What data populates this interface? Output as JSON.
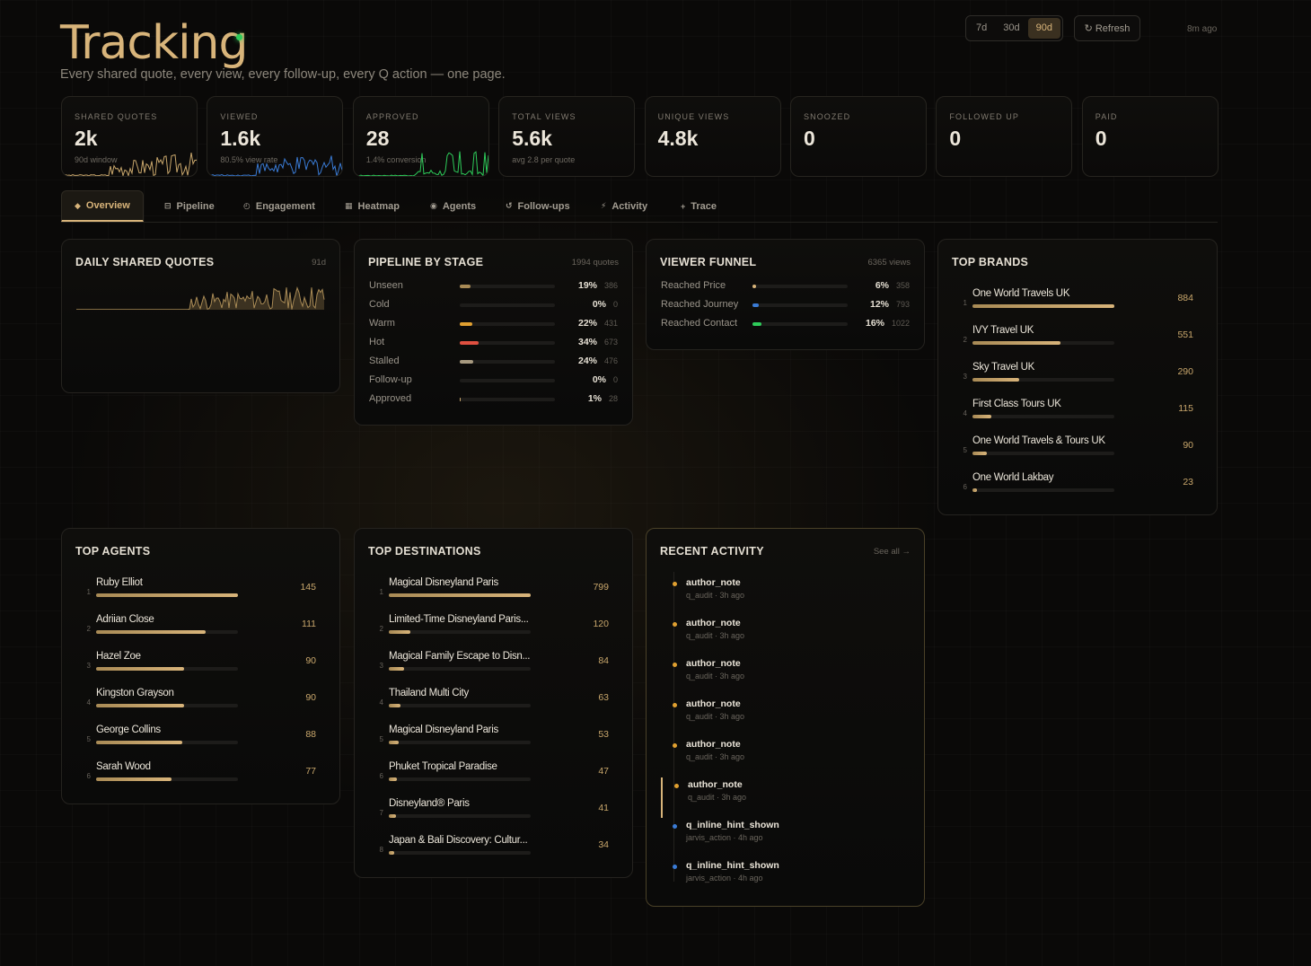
{
  "header": {
    "title": "Tracking",
    "subtitle": "Every shared quote, every view, every follow-up, every Q action — one page.",
    "ranges": [
      "7d",
      "30d",
      "90d"
    ],
    "active_range": "90d",
    "refresh_label": "Refresh",
    "updated": "8m ago"
  },
  "kpis": [
    {
      "label": "SHARED QUOTES",
      "value": "2k",
      "sub": "90d window",
      "spark_color": "#c9a76c"
    },
    {
      "label": "VIEWED",
      "value": "1.6k",
      "sub": "80.5% view rate",
      "spark_color": "#3a7bd5"
    },
    {
      "label": "APPROVED",
      "value": "28",
      "sub": "1.4% conversion",
      "spark_color": "#2ecc5a"
    },
    {
      "label": "TOTAL VIEWS",
      "value": "5.6k",
      "sub": "avg 2.8 per quote",
      "spark_color": ""
    },
    {
      "label": "UNIQUE VIEWS",
      "value": "4.8k",
      "sub": "",
      "spark_color": ""
    },
    {
      "label": "SNOOZED",
      "value": "0",
      "sub": "",
      "spark_color": ""
    },
    {
      "label": "FOLLOWED UP",
      "value": "0",
      "sub": "",
      "spark_color": ""
    },
    {
      "label": "PAID",
      "value": "0",
      "sub": "",
      "spark_color": ""
    }
  ],
  "tabs": [
    {
      "icon": "◆",
      "label": "Overview"
    },
    {
      "icon": "⊟",
      "label": "Pipeline"
    },
    {
      "icon": "◴",
      "label": "Engagement"
    },
    {
      "icon": "▦",
      "label": "Heatmap"
    },
    {
      "icon": "◉",
      "label": "Agents"
    },
    {
      "icon": "↺",
      "label": "Follow-ups"
    },
    {
      "icon": "⚡",
      "label": "Activity"
    },
    {
      "icon": "+",
      "label": "Trace"
    }
  ],
  "daily": {
    "title": "DAILY SHARED QUOTES",
    "meta": "91d"
  },
  "pipeline": {
    "title": "PIPELINE BY STAGE",
    "meta": "1994 quotes",
    "rows": [
      {
        "label": "Unseen",
        "pct": "19%",
        "count": "386",
        "frac": 0.19,
        "color": "#a88a55"
      },
      {
        "label": "Cold",
        "pct": "0%",
        "count": "0",
        "frac": 0,
        "color": "#3a7bd5"
      },
      {
        "label": "Warm",
        "pct": "22%",
        "count": "431",
        "frac": 0.22,
        "color": "#e0a030"
      },
      {
        "label": "Hot",
        "pct": "34%",
        "count": "673",
        "frac": 0.34,
        "color": "#e05040"
      },
      {
        "label": "Stalled",
        "pct": "24%",
        "count": "476",
        "frac": 0.24,
        "color": "#a89a80"
      },
      {
        "label": "Follow-up",
        "pct": "0%",
        "count": "0",
        "frac": 0,
        "color": "#d8b47a"
      },
      {
        "label": "Approved",
        "pct": "1%",
        "count": "28",
        "frac": 0.01,
        "color": "#c9a76c"
      }
    ]
  },
  "funnel": {
    "title": "VIEWER FUNNEL",
    "meta": "6365 views",
    "rows": [
      {
        "label": "Reached Price",
        "pct": "6%",
        "count": "358",
        "frac": 0.06,
        "color": "#d8b47a"
      },
      {
        "label": "Reached Journey",
        "pct": "12%",
        "count": "793",
        "frac": 0.12,
        "color": "#3a7bd5"
      },
      {
        "label": "Reached Contact",
        "pct": "16%",
        "count": "1022",
        "frac": 0.16,
        "color": "#2ecc5a"
      }
    ]
  },
  "brands": {
    "title": "TOP BRANDS",
    "items": [
      {
        "rank": "1",
        "name": "One World Travels UK",
        "value": "884",
        "frac": 1.0
      },
      {
        "rank": "2",
        "name": "IVY Travel UK",
        "value": "551",
        "frac": 0.62
      },
      {
        "rank": "3",
        "name": "Sky Travel UK",
        "value": "290",
        "frac": 0.33
      },
      {
        "rank": "4",
        "name": "First Class Tours UK",
        "value": "115",
        "frac": 0.13
      },
      {
        "rank": "5",
        "name": "One World Travels & Tours UK",
        "value": "90",
        "frac": 0.1
      },
      {
        "rank": "6",
        "name": "One World Lakbay",
        "value": "23",
        "frac": 0.03
      }
    ]
  },
  "agents": {
    "title": "TOP AGENTS",
    "items": [
      {
        "rank": "1",
        "name": "Ruby Elliot",
        "value": "145",
        "frac": 1.0
      },
      {
        "rank": "2",
        "name": "Adriian Close",
        "value": "111",
        "frac": 0.77
      },
      {
        "rank": "3",
        "name": "Hazel Zoe",
        "value": "90",
        "frac": 0.62
      },
      {
        "rank": "4",
        "name": "Kingston Grayson",
        "value": "90",
        "frac": 0.62
      },
      {
        "rank": "5",
        "name": "George Collins",
        "value": "88",
        "frac": 0.61
      },
      {
        "rank": "6",
        "name": "Sarah Wood",
        "value": "77",
        "frac": 0.53
      }
    ]
  },
  "destinations": {
    "title": "TOP DESTINATIONS",
    "items": [
      {
        "rank": "1",
        "name": "Magical Disneyland Paris",
        "value": "799",
        "frac": 1.0
      },
      {
        "rank": "2",
        "name": "Limited-Time Disneyland Paris...",
        "value": "120",
        "frac": 0.15
      },
      {
        "rank": "3",
        "name": "Magical Family Escape to Disn...",
        "value": "84",
        "frac": 0.11
      },
      {
        "rank": "4",
        "name": "Thailand Multi City",
        "value": "63",
        "frac": 0.08
      },
      {
        "rank": "5",
        "name": "Magical Disneyland Paris",
        "value": "53",
        "frac": 0.07
      },
      {
        "rank": "6",
        "name": "Phuket Tropical Paradise",
        "value": "47",
        "frac": 0.06
      },
      {
        "rank": "7",
        "name": "Disneyland® Paris",
        "value": "41",
        "frac": 0.05
      },
      {
        "rank": "8",
        "name": "Japan & Bali Discovery: Cultur...",
        "value": "34",
        "frac": 0.04
      }
    ]
  },
  "activity": {
    "title": "RECENT ACTIVITY",
    "see_all": "See all →",
    "items": [
      {
        "event": "author_note",
        "source": "q_audit · 3h ago",
        "color": "#e0a030"
      },
      {
        "event": "author_note",
        "source": "q_audit · 3h ago",
        "color": "#e0a030"
      },
      {
        "event": "author_note",
        "source": "q_audit · 3h ago",
        "color": "#e0a030"
      },
      {
        "event": "author_note",
        "source": "q_audit · 3h ago",
        "color": "#e0a030"
      },
      {
        "event": "author_note",
        "source": "q_audit · 3h ago",
        "color": "#e0a030"
      },
      {
        "event": "author_note",
        "source": "q_audit · 3h ago",
        "color": "#e0a030"
      },
      {
        "event": "q_inline_hint_shown",
        "source": "jarvis_action · 4h ago",
        "color": "#3a7bd5"
      },
      {
        "event": "q_inline_hint_shown",
        "source": "jarvis_action · 4h ago",
        "color": "#3a7bd5"
      }
    ]
  }
}
